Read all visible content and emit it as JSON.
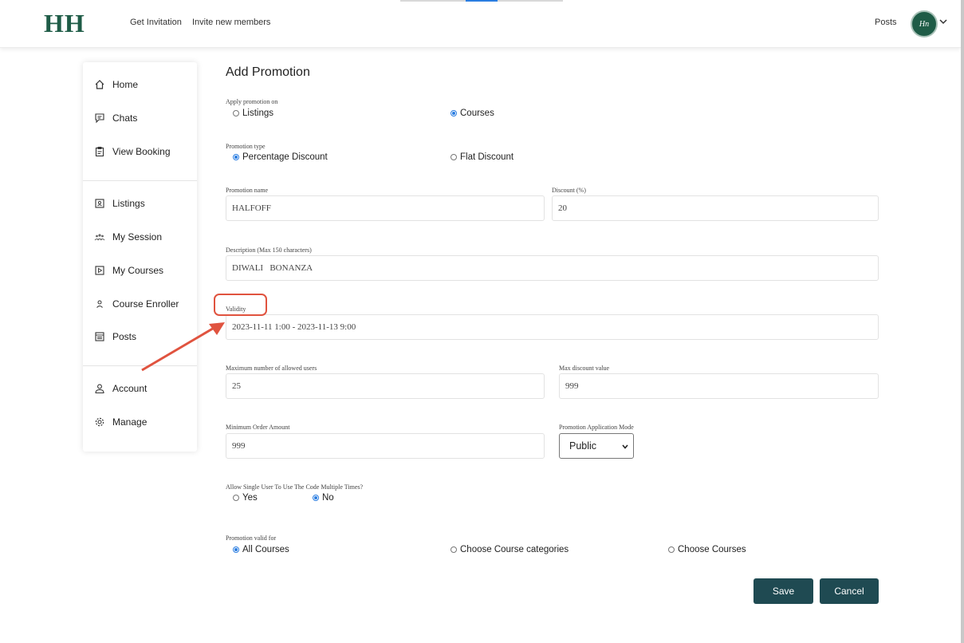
{
  "header": {
    "logo": "HH",
    "nav": [
      "Get Invitation",
      "Invite new members"
    ],
    "posts_label": "Posts",
    "avatar_text": "Hn"
  },
  "sidebar": {
    "group1": [
      "Home",
      "Chats",
      "View Booking"
    ],
    "group2": [
      "Listings",
      "My Session",
      "My Courses",
      "Course Enroller",
      "Posts"
    ],
    "group3": [
      "Account",
      "Manage"
    ]
  },
  "form": {
    "title": "Add Promotion",
    "apply_on": {
      "label": "Apply promotion on",
      "options": [
        "Listings",
        "Courses"
      ],
      "selected": "Courses"
    },
    "promo_type": {
      "label": "Promotion type",
      "options": [
        "Percentage Discount",
        "Flat Discount"
      ],
      "selected": "Percentage Discount"
    },
    "promo_name": {
      "label": "Promotion name",
      "value": "HALFOFF"
    },
    "discount": {
      "label": "Discount (%)",
      "value": "20"
    },
    "description": {
      "label": "Description (Max 150 characters)",
      "value": "DIWALI   BONANZA"
    },
    "validity": {
      "label": "Validity",
      "value": "2023-11-11 1:00 - 2023-11-13 9:00"
    },
    "max_users": {
      "label": "Maximum number of allowed users",
      "value": "25"
    },
    "max_discount": {
      "label": "Max discount value",
      "value": "999"
    },
    "min_order": {
      "label": "Minimum Order Amount",
      "value": "999"
    },
    "app_mode": {
      "label": "Promotion Application Mode",
      "value": "Public"
    },
    "multi_use": {
      "label": "Allow Single User To Use The Code Multiple Times?",
      "options": [
        "Yes",
        "No"
      ],
      "selected": "No"
    },
    "valid_for": {
      "label": "Promotion valid for",
      "options": [
        "All Courses",
        "Choose Course categories",
        "Choose Courses"
      ],
      "selected": "All Courses"
    },
    "save_label": "Save",
    "cancel_label": "Cancel"
  },
  "colors": {
    "brand": "#1f5c47",
    "button": "#1f4a52",
    "radio_selected": "#2a7de1",
    "annotation": "#e0533f"
  }
}
